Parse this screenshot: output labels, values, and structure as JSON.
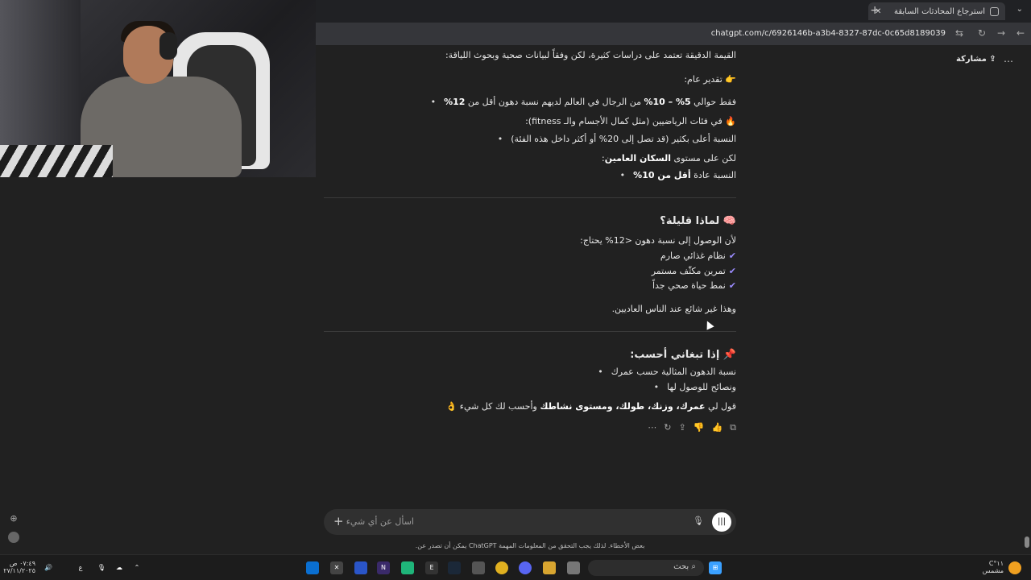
{
  "browser": {
    "tab_title": "استرجاع المحادثات السابقة",
    "url": "chatgpt.com/c/6926146b-a3b4-8327-87dc-0c65d8189039"
  },
  "header": {
    "share_label": "مشاركة",
    "more_label": "…"
  },
  "message": {
    "l1": "القيمة الدقيقة تعتمد على دراسات كثيرة، لكن وفقاً لبيانات صحية وبحوث اللياقة:",
    "l2": "👉 تقدير عام:",
    "l3a": "فقط حوالي ",
    "l3b": "5% – 10%",
    "l3c": " من الرجال في العالم لديهم نسبة دهون أقل من ",
    "l3d": "12%",
    "l4": "🔥 في فئات الرياضيين (مثل كمال الأجسام والـ fitness):",
    "l5": "النسبة أعلى بكثير (قد تصل إلى 20% أو أكثر داخل هذه الفئة)",
    "l6a": "لكن على مستوى ",
    "l6b": "السكان العامين",
    "l6c": ":",
    "l7a": "النسبة عادة ",
    "l7b": "أقل من 10%",
    "h_why": "🧠 لماذا قليلة؟",
    "why_intro": "لأن الوصول إلى نسبة دهون <12% يحتاج:",
    "why_items": [
      "نظام غذائي صارم",
      "تمرين مكثّف مستمر",
      "نمط حياة صحي جداً"
    ],
    "why_end": "وهذا غير شائع عند الناس العاديين.",
    "h_calc": "📌 إذا تبغاني أحسب:",
    "calc_items": [
      "نسبة الدهون المثالية حسب عمرك",
      "ونصائح للوصول لها"
    ],
    "final_a": "قول لي ",
    "final_b": "عمرك، وزنك، طولك، ومستوى نشاطك",
    "final_c": " وأحسب لك كل شيء 👌"
  },
  "composer": {
    "placeholder": "اسأل عن أي شيء",
    "plus": "+",
    "disclaimer": "بعض الأخطاء. لذلك يجب التحقق من المعلومات المهمة ChatGPT يمكن أن تصدر عن."
  },
  "taskbar": {
    "search": "بحث",
    "weather_temp": "١١°C",
    "weather_desc": "مشمس",
    "time": "٠٧:٤٩ ص",
    "date": "٢٧/١١/٢٠٢٥",
    "lang": "ع"
  },
  "colors": {
    "accent_check": "#9b8cff",
    "bg": "#212121"
  }
}
